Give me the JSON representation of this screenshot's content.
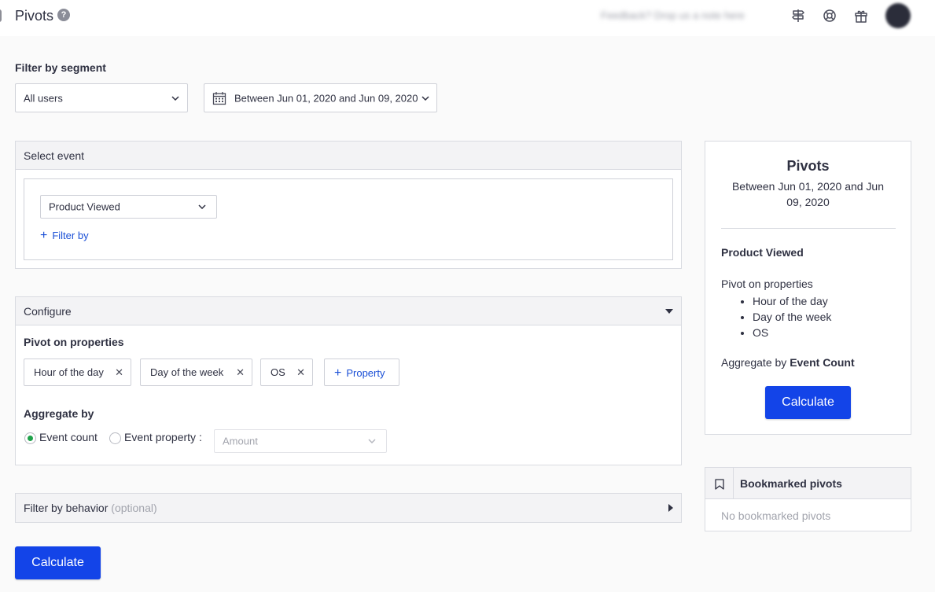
{
  "header": {
    "title": "Pivots",
    "help": "?",
    "feedback": "Feedback? Drop us a note here"
  },
  "segment": {
    "label": "Filter by segment",
    "users": "All users",
    "date_range": "Between Jun 01, 2020 and Jun 09, 2020"
  },
  "event": {
    "title": "Select event",
    "selected": "Product Viewed",
    "filter_by": "Filter by"
  },
  "configure": {
    "title": "Configure",
    "pivot_label": "Pivot on properties",
    "properties": [
      "Hour of the day",
      "Day of the week",
      "OS"
    ],
    "add_property": "Property",
    "aggregate_label": "Aggregate by",
    "event_count": "Event count",
    "event_property": "Event property :",
    "amount_placeholder": "Amount"
  },
  "behavior": {
    "title": "Filter by behavior",
    "optional": "(optional)"
  },
  "calculate_label": "Calculate",
  "summary": {
    "title": "Pivots",
    "date_range": "Between Jun 01, 2020 and Jun 09, 2020",
    "event": "Product Viewed",
    "pivot_label": "Pivot on properties",
    "properties": [
      "Hour of the day",
      "Day of the week",
      "OS"
    ],
    "aggregate_prefix": "Aggregate by",
    "aggregate_value": "Event Count",
    "calculate": "Calculate"
  },
  "bookmarks": {
    "title": "Bookmarked pivots",
    "empty": "No bookmarked pivots"
  },
  "colors": {
    "primary": "#1344e8",
    "link": "#1a4fd6",
    "radio_selected": "#1fa24a"
  }
}
